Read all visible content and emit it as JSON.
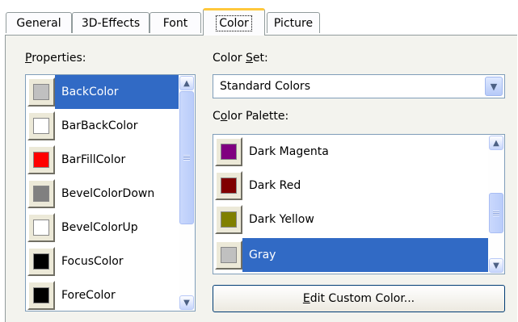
{
  "tabs": [
    {
      "label": "General",
      "active": false
    },
    {
      "label": "3D-Effects",
      "active": false
    },
    {
      "label": "Font",
      "active": false
    },
    {
      "label": "Color",
      "active": true
    },
    {
      "label": "Picture",
      "active": false
    }
  ],
  "properties": {
    "label_mnemonic": "P",
    "label_rest": "roperties:",
    "items": [
      {
        "label": "BackColor",
        "color": "#c0c0c0",
        "selected": true
      },
      {
        "label": "BarBackColor",
        "color": "#ffffff",
        "selected": false
      },
      {
        "label": "BarFillColor",
        "color": "#ff0000",
        "selected": false
      },
      {
        "label": "BevelColorDown",
        "color": "#808080",
        "selected": false
      },
      {
        "label": "BevelColorUp",
        "color": "#ffffff",
        "selected": false
      },
      {
        "label": "FocusColor",
        "color": "#000000",
        "selected": false
      },
      {
        "label": "ForeColor",
        "color": "#000000",
        "selected": false
      }
    ]
  },
  "color_set": {
    "label_before": "Color ",
    "label_mnemonic": "S",
    "label_after": "et:",
    "value": "Standard Colors"
  },
  "color_palette": {
    "label_before": "C",
    "label_mnemonic": "o",
    "label_after": "lor Palette:",
    "items": [
      {
        "label": "Dark Magenta",
        "color": "#800080",
        "selected": false
      },
      {
        "label": "Dark Red",
        "color": "#800000",
        "selected": false
      },
      {
        "label": "Dark Yellow",
        "color": "#808000",
        "selected": false
      },
      {
        "label": "Gray",
        "color": "#c0c0c0",
        "selected": true
      }
    ]
  },
  "edit_button": {
    "mnemonic": "E",
    "rest": "dit Custom Color..."
  },
  "colors": {
    "selection": "#316ac5",
    "tab_accent": "#ffc83c",
    "panel": "#f3f3ee"
  },
  "icons": {
    "scroll_up": "▲",
    "scroll_down": "▼",
    "dropdown": "▼"
  }
}
